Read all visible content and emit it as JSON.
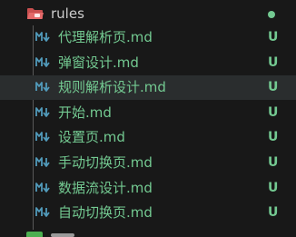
{
  "folder": {
    "name": "rules",
    "icon": "folder-open-red-icon",
    "status_color": "#73c991"
  },
  "files": [
    {
      "name": "代理解析页.md",
      "status": "U",
      "icon": "markdown-icon"
    },
    {
      "name": "弹窗设计.md",
      "status": "U",
      "icon": "markdown-icon"
    },
    {
      "name": "规则解析设计.md",
      "status": "U",
      "icon": "markdown-icon"
    },
    {
      "name": "开始.md",
      "status": "U",
      "icon": "markdown-icon"
    },
    {
      "name": "设置页.md",
      "status": "U",
      "icon": "markdown-icon"
    },
    {
      "name": "手动切换页.md",
      "status": "U",
      "icon": "markdown-icon"
    },
    {
      "name": "数据流设计.md",
      "status": "U",
      "icon": "markdown-icon"
    },
    {
      "name": "自动切换页.md",
      "status": "U",
      "icon": "markdown-icon"
    }
  ],
  "selected_file": "规则解析设计.md",
  "colors": {
    "background": "#181818",
    "untracked_green": "#73c991",
    "markdown_icon": "#519aba",
    "folder_icon": "#e05a5a",
    "selected_row": "#2a2d2e"
  }
}
